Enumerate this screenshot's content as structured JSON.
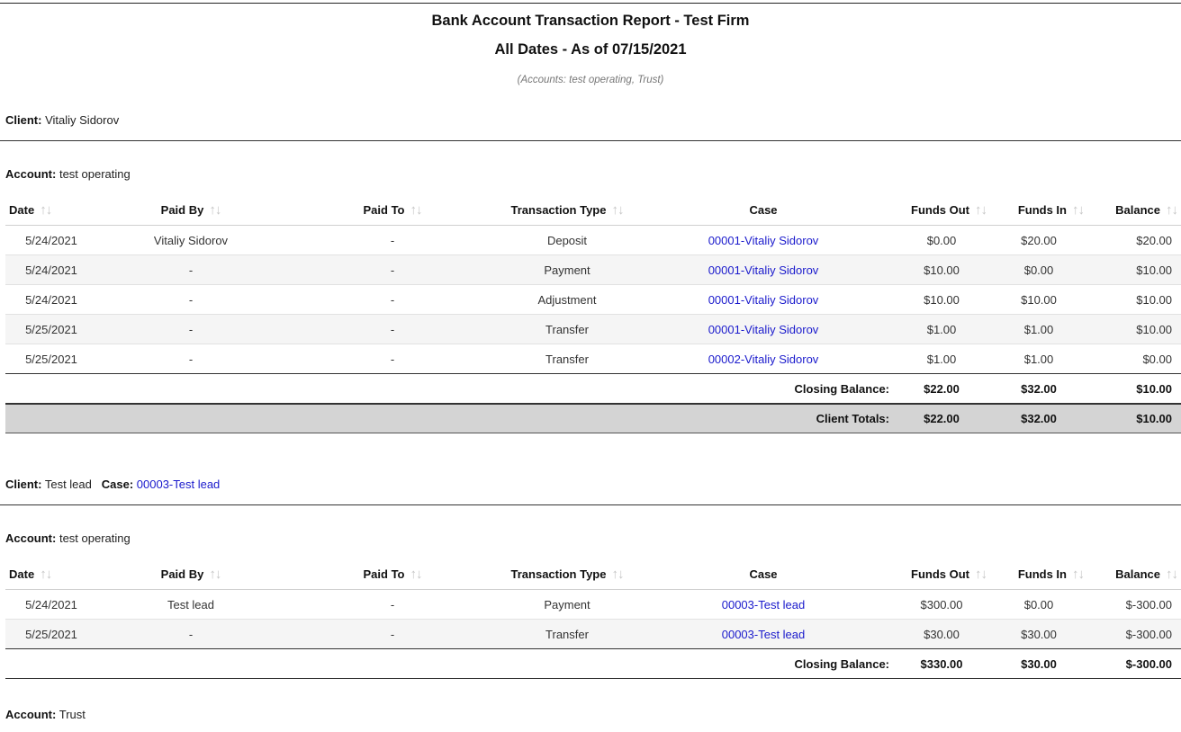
{
  "report": {
    "title": "Bank Account Transaction Report - Test Firm",
    "subtitle": "All Dates - As of 07/15/2021",
    "accounts": "(Accounts: test operating, Trust)"
  },
  "labels": {
    "client": "Client:",
    "case": "Case:",
    "account": "Account:",
    "closing_balance": "Closing Balance:",
    "client_totals": "Client Totals:"
  },
  "icons": {
    "sort": "sort-up-down-arrows-icon"
  },
  "columns": [
    "Date",
    "Paid By",
    "Paid To",
    "Transaction Type",
    "Case",
    "Funds Out",
    "Funds In",
    "Balance"
  ],
  "sections": [
    {
      "client": "Vitaliy Sidorov",
      "account": "test operating",
      "rows": [
        [
          "5/24/2021",
          "Vitaliy Sidorov",
          "-",
          "Deposit",
          "00001-Vitaliy Sidorov",
          "$0.00",
          "$20.00",
          "$20.00"
        ],
        [
          "5/24/2021",
          "-",
          "-",
          "Payment",
          "00001-Vitaliy Sidorov",
          "$10.00",
          "$0.00",
          "$10.00"
        ],
        [
          "5/24/2021",
          "-",
          "-",
          "Adjustment",
          "00001-Vitaliy Sidorov",
          "$10.00",
          "$10.00",
          "$10.00"
        ],
        [
          "5/25/2021",
          "-",
          "-",
          "Transfer",
          "00001-Vitaliy Sidorov",
          "$1.00",
          "$1.00",
          "$10.00"
        ],
        [
          "5/25/2021",
          "-",
          "-",
          "Transfer",
          "00002-Vitaliy Sidorov",
          "$1.00",
          "$1.00",
          "$0.00"
        ]
      ],
      "closing": [
        "$22.00",
        "$32.00",
        "$10.00"
      ],
      "totals": [
        "$22.00",
        "$32.00",
        "$10.00"
      ]
    },
    {
      "client": "Test lead",
      "case": "00003-Test lead",
      "account": "test operating",
      "rows": [
        [
          "5/24/2021",
          "Test lead",
          "-",
          "Payment",
          "00003-Test lead",
          "$300.00",
          "$0.00",
          "$-300.00"
        ],
        [
          "5/25/2021",
          "-",
          "-",
          "Transfer",
          "00003-Test lead",
          "$30.00",
          "$30.00",
          "$-300.00"
        ]
      ],
      "closing": [
        "$330.00",
        "$30.00",
        "$-300.00"
      ],
      "account2": "Trust"
    }
  ]
}
